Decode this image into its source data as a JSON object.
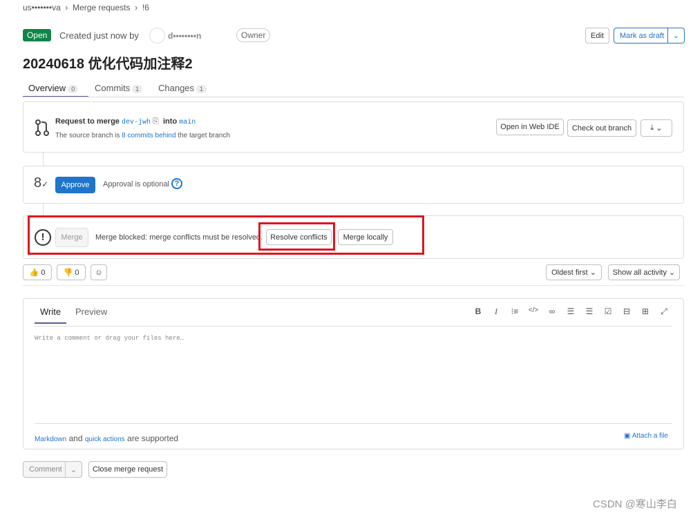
{
  "breadcrumb": {
    "project": "us•••••••va",
    "merge_requests": "Merge requests",
    "mr_id": "!6"
  },
  "header": {
    "status": "Open",
    "created": "Created just now by",
    "author": "d••••••••n",
    "role": "Owner",
    "edit": "Edit",
    "mark_draft": "Mark as draft",
    "title": "20240618 优化代码加注释2"
  },
  "tabs": [
    {
      "label": "Overview",
      "count": "0"
    },
    {
      "label": "Commits",
      "count": "1"
    },
    {
      "label": "Changes",
      "count": "1"
    }
  ],
  "merge_info": {
    "request_to_merge": "Request to merge",
    "source": "dev-jwh",
    "into": "into",
    "target": "main",
    "behind_prefix": "The source branch is",
    "behind_link": "8 commits behind",
    "behind_suffix": "the target branch",
    "open_ide": "Open in Web IDE",
    "checkout": "Check out branch"
  },
  "approval": {
    "approve": "Approve",
    "optional": "Approval is optional"
  },
  "merge": {
    "merge": "Merge",
    "blocked": "Merge blocked: merge conflicts must be resolved.",
    "resolve": "Resolve conflicts",
    "locally": "Merge locally"
  },
  "reactions": {
    "thumbs_up": "0",
    "thumbs_down": "0",
    "sort": "Oldest first",
    "filter": "Show all activity"
  },
  "editor": {
    "write": "Write",
    "preview": "Preview",
    "placeholder": "Write a comment or drag your files here…",
    "markdown": "Markdown",
    "and": "and",
    "quick_actions": "quick actions",
    "supported": "are supported",
    "attach": "Attach a file"
  },
  "footer": {
    "comment": "Comment",
    "close": "Close merge request"
  },
  "watermark": "CSDN @寒山李白"
}
